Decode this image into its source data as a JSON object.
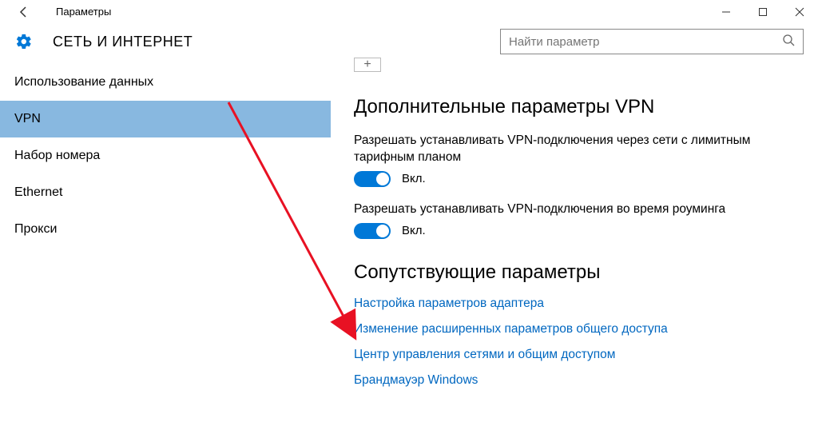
{
  "window": {
    "title": "Параметры"
  },
  "header": {
    "title": "СЕТЬ И ИНТЕРНЕТ",
    "search_placeholder": "Найти параметр"
  },
  "sidebar": {
    "items": [
      {
        "label": "Использование данных",
        "selected": false
      },
      {
        "label": "VPN",
        "selected": true
      },
      {
        "label": "Набор номера",
        "selected": false
      },
      {
        "label": "Ethernet",
        "selected": false
      },
      {
        "label": "Прокси",
        "selected": false
      }
    ]
  },
  "content": {
    "advanced_heading": "Дополнительные параметры VPN",
    "settings": [
      {
        "label": "Разрешать устанавливать VPN-подключения через сети с лимитным тарифным планом",
        "state": "Вкл.",
        "on": true
      },
      {
        "label": "Разрешать устанавливать VPN-подключения во время роуминга",
        "state": "Вкл.",
        "on": true
      }
    ],
    "related_heading": "Сопутствующие параметры",
    "links": [
      "Настройка параметров адаптера",
      "Изменение расширенных параметров общего доступа",
      "Центр управления сетями и общим доступом",
      "Брандмауэр Windows"
    ]
  }
}
